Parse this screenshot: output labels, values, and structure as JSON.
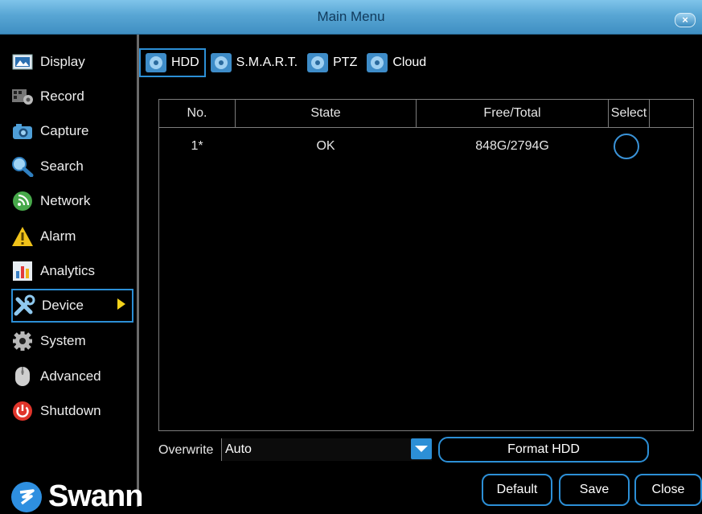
{
  "window": {
    "title": "Main Menu",
    "close_label": "×"
  },
  "sidebar": {
    "items": [
      {
        "label": "Display",
        "icon": "display-icon"
      },
      {
        "label": "Record",
        "icon": "record-icon"
      },
      {
        "label": "Capture",
        "icon": "camera-icon"
      },
      {
        "label": "Search",
        "icon": "search-icon"
      },
      {
        "label": "Network",
        "icon": "network-icon"
      },
      {
        "label": "Alarm",
        "icon": "alarm-icon"
      },
      {
        "label": "Analytics",
        "icon": "analytics-icon"
      },
      {
        "label": "Device",
        "icon": "device-icon",
        "active": true
      },
      {
        "label": "System",
        "icon": "gear-icon"
      },
      {
        "label": "Advanced",
        "icon": "mouse-icon"
      },
      {
        "label": "Shutdown",
        "icon": "power-icon"
      }
    ],
    "logo_text": "Swann"
  },
  "tabs": [
    {
      "label": "HDD",
      "active": true
    },
    {
      "label": "S.M.A.R.T."
    },
    {
      "label": "PTZ"
    },
    {
      "label": "Cloud"
    }
  ],
  "table": {
    "columns": [
      "No.",
      "State",
      "Free/Total",
      "Select"
    ],
    "rows": [
      {
        "no": "1*",
        "state": "OK",
        "free_total": "848G/2794G",
        "selected": false
      }
    ]
  },
  "overwrite": {
    "label": "Overwrite",
    "value": "Auto"
  },
  "buttons": {
    "format": "Format HDD",
    "default": "Default",
    "save": "Save",
    "close": "Close"
  },
  "colors": {
    "accent": "#2c8fd6",
    "title_bar": "#58a6d4",
    "arrow": "#f3d21b"
  }
}
